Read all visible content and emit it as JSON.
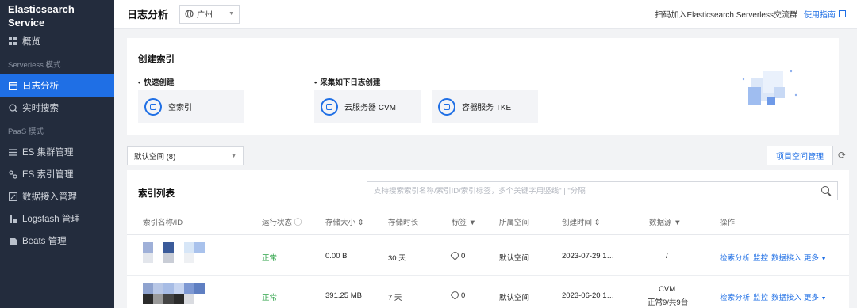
{
  "sidebar": {
    "brand_line1": "Elasticsearch",
    "brand_line2": "Service",
    "overview": "概览",
    "section_serverless": "Serverless 模式",
    "log_analysis": "日志分析",
    "realtime_search": "实时搜索",
    "section_paas": "PaaS 模式",
    "es_cluster": "ES 集群管理",
    "es_index": "ES 索引管理",
    "data_ingest": "数据接入管理",
    "logstash": "Logstash 管理",
    "beats": "Beats 管理"
  },
  "header": {
    "title": "日志分析",
    "region": "广州",
    "qr_text": "扫码加入Elasticsearch Serverless交流群",
    "guide_link": "使用指南"
  },
  "create": {
    "title": "创建索引",
    "quick_label": "快速创建",
    "collect_label": "采集如下日志创建",
    "empty_index": "空索引",
    "cvm": "云服务器 CVM",
    "tke": "容器服务 TKE"
  },
  "space": {
    "selected": "默认空间 (8)",
    "manage_button": "项目空间管理"
  },
  "list": {
    "title": "索引列表",
    "search_placeholder": "支持搜索索引名称/索引ID/索引标签，多个关键字用竖线\" | \"分隔",
    "columns": [
      "索引名称/ID",
      "运行状态",
      "存储大小",
      "存储时长",
      "标签",
      "所属空间",
      "创建时间",
      "数据源",
      "操作"
    ],
    "rows": [
      {
        "status": "正常",
        "size": "0.00 B",
        "duration": "30 天",
        "tags": "0",
        "space": "默认空间",
        "created": "2023-07-29 1…",
        "source": "/",
        "source_sub": "",
        "actions": [
          "检索分析",
          "监控",
          "数据接入",
          "更多"
        ]
      },
      {
        "status": "正常",
        "size": "391.25 MB",
        "duration": "7 天",
        "tags": "0",
        "space": "默认空间",
        "created": "2023-06-20 1…",
        "source": "CVM",
        "source_sub": "正常9/共9台",
        "actions": [
          "检索分析",
          "监控",
          "数据接入",
          "更多"
        ]
      }
    ]
  },
  "colors": {
    "accent": "#1f6fe5",
    "sidebar_bg": "#232c3d",
    "status_ok": "#2ba246"
  }
}
